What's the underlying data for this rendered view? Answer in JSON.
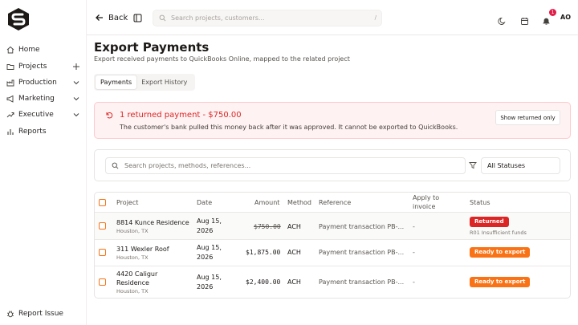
{
  "nav": {
    "items": [
      {
        "label": "Home"
      },
      {
        "label": "Projects"
      },
      {
        "label": "Production"
      },
      {
        "label": "Marketing"
      },
      {
        "label": "Executive"
      },
      {
        "label": "Reports"
      }
    ],
    "report_issue": "Report Issue"
  },
  "topbar": {
    "back_label": "Back",
    "search_placeholder": "Search projects, customers...",
    "search_shortcut": "/",
    "notification_count": "1",
    "avatar_initials": "AO"
  },
  "page": {
    "title": "Export Payments",
    "subtitle": "Export received payments to QuickBooks Online, mapped to the related project"
  },
  "tabs": [
    {
      "label": "Payments",
      "active": true
    },
    {
      "label": "Export History",
      "active": false
    }
  ],
  "alert": {
    "title": "1 returned payment - $750.00",
    "description": "The customer's bank pulled this money back after it was approved. It cannot be exported to QuickBooks.",
    "button_label": "Show returned only"
  },
  "filters": {
    "search_placeholder": "Search projects, methods, references...",
    "status_value": "All Statuses"
  },
  "table": {
    "headers": {
      "project": "Project",
      "date": "Date",
      "amount": "Amount",
      "method": "Method",
      "reference": "Reference",
      "apply_line1": "Apply to",
      "apply_line2": "invoice",
      "status": "Status"
    },
    "rows": [
      {
        "project": "8814 Kunce Residence",
        "location": "Houston, TX",
        "date_line1": "Aug 15,",
        "date_line2": "2026",
        "amount": "$750.00",
        "method": "ACH",
        "reference": "Payment transaction PB-...",
        "apply_to": "-",
        "status": "Returned",
        "status_note": "R01 Insufficient funds"
      },
      {
        "project": "311 Wexler Roof",
        "location": "Houston, TX",
        "date_line1": "Aug 15,",
        "date_line2": "2026",
        "amount": "$1,875.00",
        "method": "ACH",
        "reference": "Payment transaction PB-...",
        "apply_to": "-",
        "status": "Ready to export"
      },
      {
        "project_line1": "4420 Caligur",
        "project_line2": "Residence",
        "location": "Houston, TX",
        "date_line1": "Aug 15,",
        "date_line2": "2026",
        "amount": "$2,400.00",
        "method": "ACH",
        "reference": "Payment transaction PB-...",
        "apply_to": "-",
        "status": "Ready to export"
      }
    ]
  },
  "colors": {
    "accent": "#f97316",
    "danger": "#dc2626",
    "alert_bg": "#fef2f2"
  }
}
